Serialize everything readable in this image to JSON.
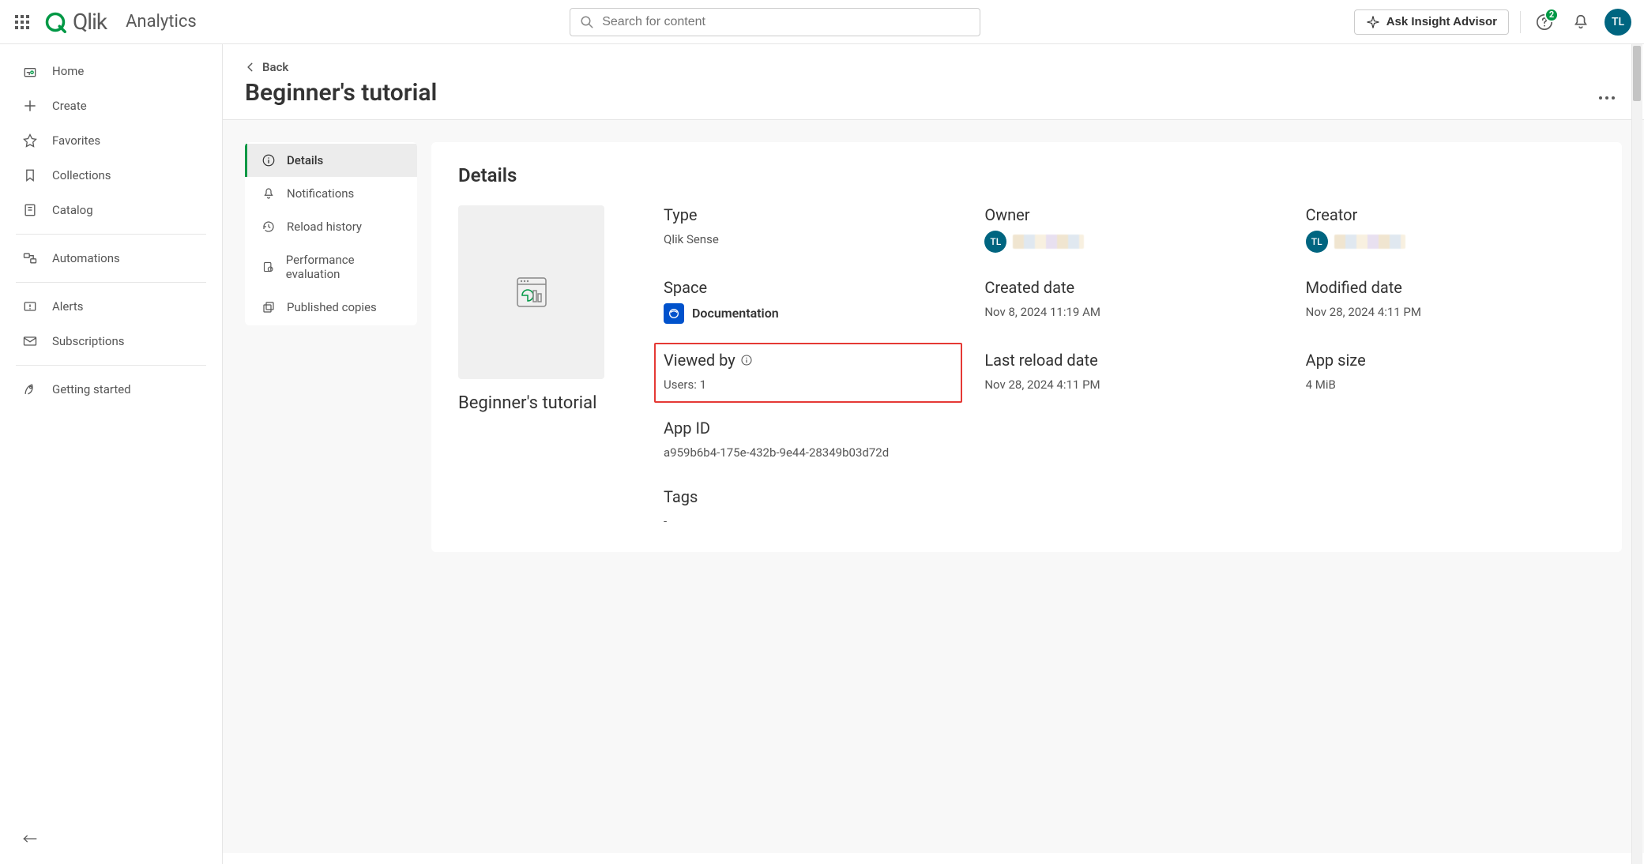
{
  "header": {
    "product": "Analytics",
    "search_placeholder": "Search for content",
    "ask_label": "Ask Insight Advisor",
    "notification_count": "2",
    "avatar_initials": "TL"
  },
  "sidebar": {
    "items": [
      {
        "label": "Home"
      },
      {
        "label": "Create"
      },
      {
        "label": "Favorites"
      },
      {
        "label": "Collections"
      },
      {
        "label": "Catalog"
      },
      {
        "label": "Automations"
      },
      {
        "label": "Alerts"
      },
      {
        "label": "Subscriptions"
      },
      {
        "label": "Getting started"
      }
    ]
  },
  "page": {
    "back_label": "Back",
    "title": "Beginner's tutorial"
  },
  "subnav": {
    "items": [
      {
        "label": "Details"
      },
      {
        "label": "Notifications"
      },
      {
        "label": "Reload history"
      },
      {
        "label": "Performance evaluation"
      },
      {
        "label": "Published copies"
      }
    ]
  },
  "details": {
    "panel_title": "Details",
    "preview_caption": "Beginner's tutorial",
    "type_label": "Type",
    "type_value": "Qlik Sense",
    "owner_label": "Owner",
    "owner_initials": "TL",
    "creator_label": "Creator",
    "creator_initials": "TL",
    "space_label": "Space",
    "space_value": "Documentation",
    "created_label": "Created date",
    "created_value": "Nov 8, 2024 11:19 AM",
    "modified_label": "Modified date",
    "modified_value": "Nov 28, 2024 4:11 PM",
    "viewed_label": "Viewed by",
    "viewed_value": "Users: 1",
    "reload_label": "Last reload date",
    "reload_value": "Nov 28, 2024 4:11 PM",
    "size_label": "App size",
    "size_value": "4 MiB",
    "appid_label": "App ID",
    "appid_value": "a959b6b4-175e-432b-9e44-28349b03d72d",
    "tags_label": "Tags",
    "tags_value": "-"
  }
}
